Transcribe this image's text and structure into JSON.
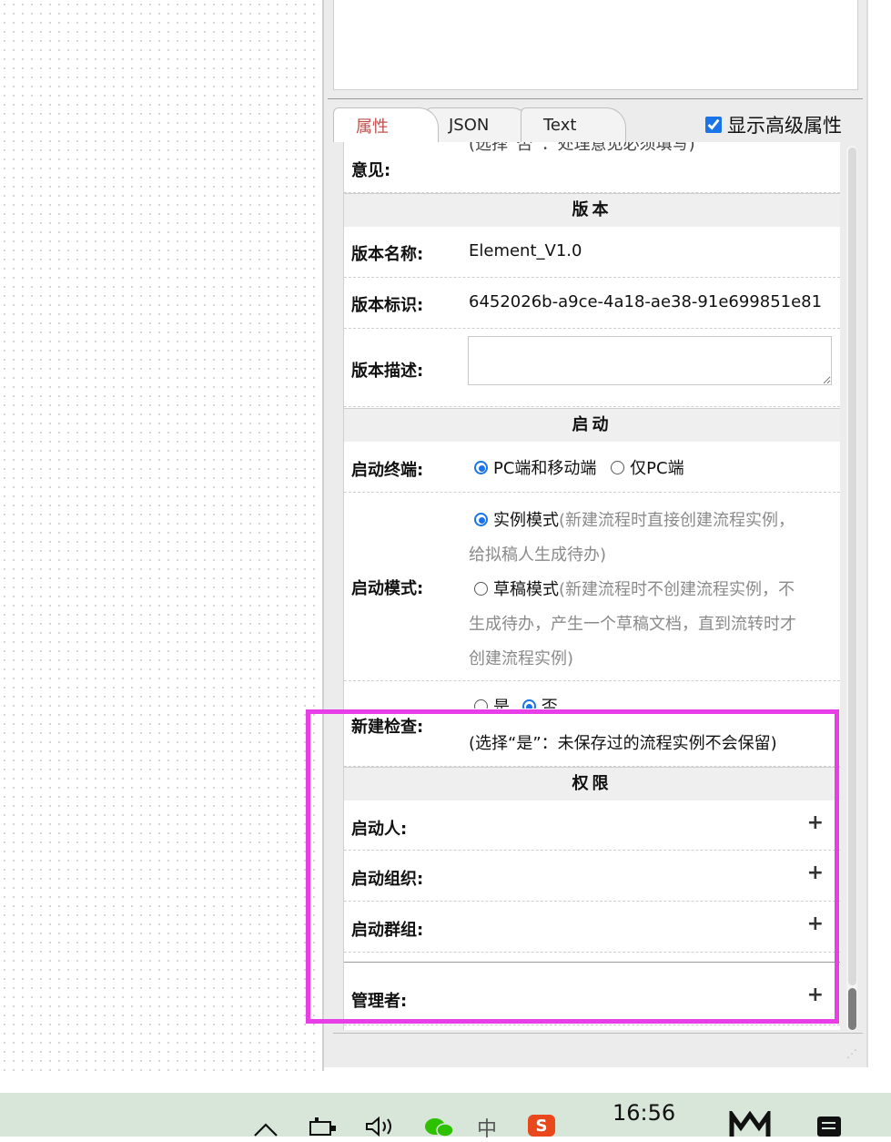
{
  "tabs": [
    {
      "label": "属性",
      "active": true
    },
    {
      "label": "JSON",
      "active": false
    },
    {
      "label": "Text",
      "active": false
    }
  ],
  "advanced": {
    "label": "显示高级属性",
    "checked": true
  },
  "opinion": {
    "label": "意见:",
    "clipped_hint": "(选择“否”：处理意见必须填写)"
  },
  "version": {
    "section_title": "版本",
    "name_label": "版本名称:",
    "name_value": "Element_V1.0",
    "id_label": "版本标识:",
    "id_value": "6452026b-a9ce-4a18-ae38-91e699851e81",
    "desc_label": "版本描述:"
  },
  "start": {
    "section_title": "启动",
    "terminal_label": "启动终端:",
    "terminal_options": [
      {
        "label": "PC端和移动端",
        "selected": true
      },
      {
        "label": "仅PC端",
        "selected": false
      }
    ],
    "mode_label": "启动模式:",
    "mode_instance_label": "实例模式",
    "mode_instance_hint": "(新建流程时直接创建流程实例，",
    "mode_instance_hint2": "给拟稿人生成待办)",
    "mode_draft_label": "草稿模式",
    "mode_draft_hint": "(新建流程时不创建流程实例，不",
    "mode_draft_hint2": "生成待办，产生一个草稿文档，直到流转时才",
    "mode_draft_hint3": "创建流程实例)",
    "check_label": "新建检查:",
    "check_yes": "是",
    "check_no": "否",
    "check_hint": "(选择“是”：未保存过的流程实例不会保留)"
  },
  "permission": {
    "section_title": "权限",
    "starter_label": "启动人:",
    "org_label": "启动组织:",
    "group_label": "启动群组:",
    "manager_label": "管理者:",
    "plus": "+"
  },
  "taskbar": {
    "time": "16:56",
    "ime": "中",
    "sogou": "S"
  },
  "colors": {
    "highlight": "#e83ee8",
    "active_tab": "#c0504d",
    "radio": "#1a73e8"
  }
}
